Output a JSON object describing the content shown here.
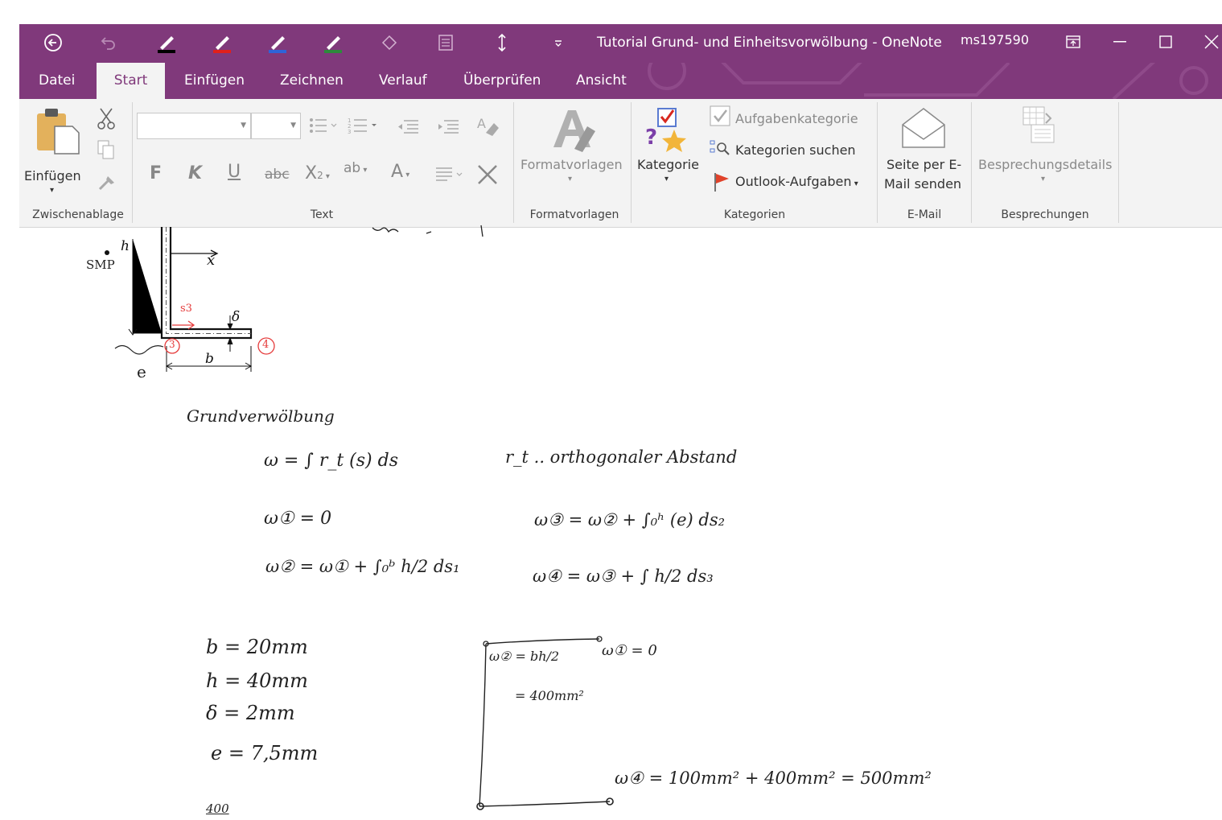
{
  "window": {
    "title": "Tutorial Grund- und Einheitsvorwölbung  -  OneNote",
    "user": "ms197590"
  },
  "quick_access": {
    "back_icon": "back-arrow-icon",
    "undo_icon": "undo-icon",
    "pens": [
      {
        "name": "pen-black-icon",
        "color": "#000000"
      },
      {
        "name": "pen-red-icon",
        "color": "#e0201b"
      },
      {
        "name": "pen-blue-icon",
        "color": "#2e64d8"
      },
      {
        "name": "pen-green-icon",
        "color": "#2d8a3c"
      }
    ]
  },
  "tabs": [
    {
      "label": "Datei",
      "active": false
    },
    {
      "label": "Start",
      "active": true
    },
    {
      "label": "Einfügen",
      "active": false
    },
    {
      "label": "Zeichnen",
      "active": false
    },
    {
      "label": "Verlauf",
      "active": false
    },
    {
      "label": "Überprüfen",
      "active": false
    },
    {
      "label": "Ansicht",
      "active": false
    }
  ],
  "ribbon": {
    "clipboard": {
      "paste_label": "Einfügen",
      "group_label": "Zwischenablage"
    },
    "text": {
      "group_label": "Text",
      "bold": "F",
      "italic": "K",
      "underline": "U",
      "strike": "abc",
      "subscript": "X",
      "subscript_small": "2",
      "highlight": "ab",
      "fontcolor": "A"
    },
    "styles": {
      "label": "Formatvorlagen",
      "group_label": "Formatvorlagen"
    },
    "tags": {
      "category_label": "Kategorie",
      "task_category": "Aufgabenkategorie",
      "find_tags": "Kategorien suchen",
      "outlook_tasks": "Outlook-Aufgaben",
      "group_label": "Kategorien"
    },
    "email": {
      "line1": "Seite per E-",
      "line2": "Mail senden",
      "group_label": "E-Mail"
    },
    "meetings": {
      "label": "Besprechungsdetails",
      "group_label": "Besprechungen"
    }
  },
  "note": {
    "figure": {
      "smp_label": "SMP",
      "h_label": "h",
      "x_label": "x",
      "s3_label": "s3",
      "delta_label": "δ",
      "b_label": "b",
      "e_label": "e",
      "node3": "3",
      "node4": "4"
    },
    "heading": "Grundverwölbung",
    "eq_main": "ω = ∫ r_t (s) ds",
    "eq_rt": "r_t .. orthogonaler Abstand",
    "eq_w1": "ω① = 0",
    "eq_w2": "ω② = ω① + ∫₀ᵇ h/2 ds₁",
    "eq_w3": "ω③ = ω② + ∫₀ʰ (e) ds₂",
    "eq_w4": "ω④ = ω③ + ∫ h/2 ds₃",
    "params": [
      "b = 20mm",
      "h = 40mm",
      "δ = 2mm",
      "e = 7,5mm",
      "400"
    ],
    "diagram": {
      "w2_label": "ω② = bh/2",
      "w2_value": "= 400mm²",
      "w1_label": "ω① = 0",
      "w4_label": "ω④ = 100mm² + 400mm² = 500mm²"
    }
  }
}
